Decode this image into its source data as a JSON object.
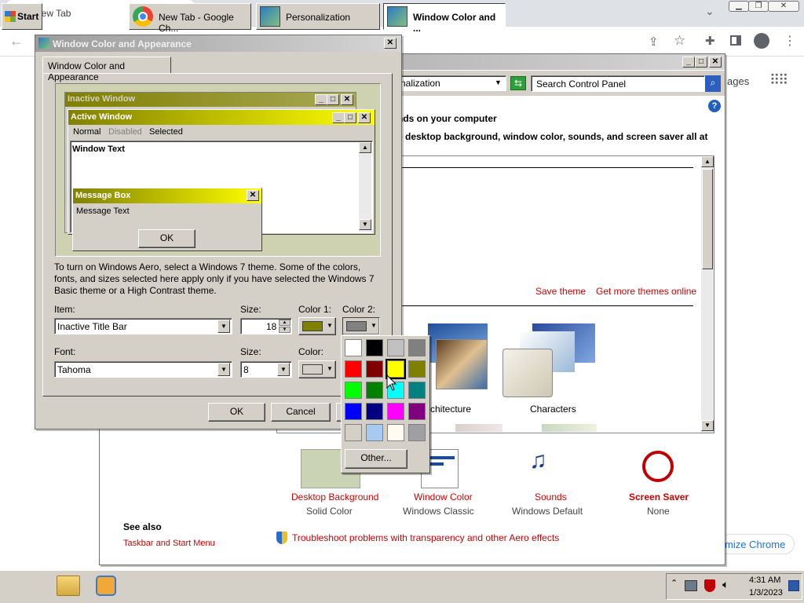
{
  "chrome": {
    "tab_title": "New Tab",
    "side_text": "ages",
    "customize_text": "mize Chrome"
  },
  "personalization": {
    "address": "nalization",
    "search_placeholder": "Search Control Panel",
    "heading": "nds on your computer",
    "subheading": "e desktop background, window color, sounds, and screen saver all at",
    "save_theme": "Save theme",
    "more_themes": "Get more themes online",
    "theme_architecture": "chitecture",
    "theme_characters": "Characters",
    "bottom": [
      {
        "link": "Desktop Background",
        "value": "Solid Color"
      },
      {
        "link": "Window Color",
        "value": "Windows Classic"
      },
      {
        "link": "Sounds",
        "value": "Windows Default"
      },
      {
        "link": "Screen Saver",
        "value": "None"
      }
    ],
    "see_also": "See also",
    "taskbar_link": "Taskbar and Start Menu",
    "troubleshoot": "Troubleshoot problems with transparency and other Aero effects"
  },
  "dialog": {
    "title": "Window Color and Appearance",
    "tab": "Window Color and Appearance",
    "preview": {
      "inactive": "Inactive Window",
      "active": "Active Window",
      "menu_normal": "Normal",
      "menu_disabled": "Disabled",
      "menu_selected": "Selected",
      "window_text": "Window Text",
      "msgbox_title": "Message Box",
      "msgbox_text": "Message Text",
      "ok": "OK"
    },
    "info": "To turn on Windows Aero, select a Windows 7 theme.  Some of the colors, fonts, and sizes selected here apply only if you have selected the Windows 7 Basic theme or a High Contrast theme.",
    "item_label": "Item:",
    "item_value": "Inactive Title Bar",
    "size_label": "Size:",
    "size_value": "18",
    "color1_label": "Color 1:",
    "color2_label": "Color 2:",
    "font_label": "Font:",
    "font_value": "Tahoma",
    "font_size_label": "Size:",
    "font_size_value": "8",
    "font_color_label": "Color:",
    "ok": "OK",
    "cancel": "Cancel"
  },
  "palette": {
    "other": "Other...",
    "colors": [
      "#ffffff",
      "#000000",
      "#c0c0c0",
      "#808080",
      "#ff0000",
      "#800000",
      "#ffff00",
      "#808000",
      "#00ff00",
      "#008000",
      "#00ffff",
      "#008080",
      "#0000ff",
      "#000080",
      "#ff00ff",
      "#800080",
      "#d4d0c8",
      "#a6caf0",
      "#fffbf0",
      "#a0a0a4"
    ],
    "selected": 6
  },
  "taskbar": {
    "start": "Start",
    "tasks": [
      "New Tab - Google Ch...",
      "Personalization",
      "Window Color and ..."
    ],
    "time": "4:31 AM",
    "date": "1/3/2023"
  },
  "colors": {
    "color1": "#808000",
    "color2": "#808080",
    "active_title_start": "#808000",
    "active_title_end": "#ffff00",
    "link_red": "#d00000"
  }
}
